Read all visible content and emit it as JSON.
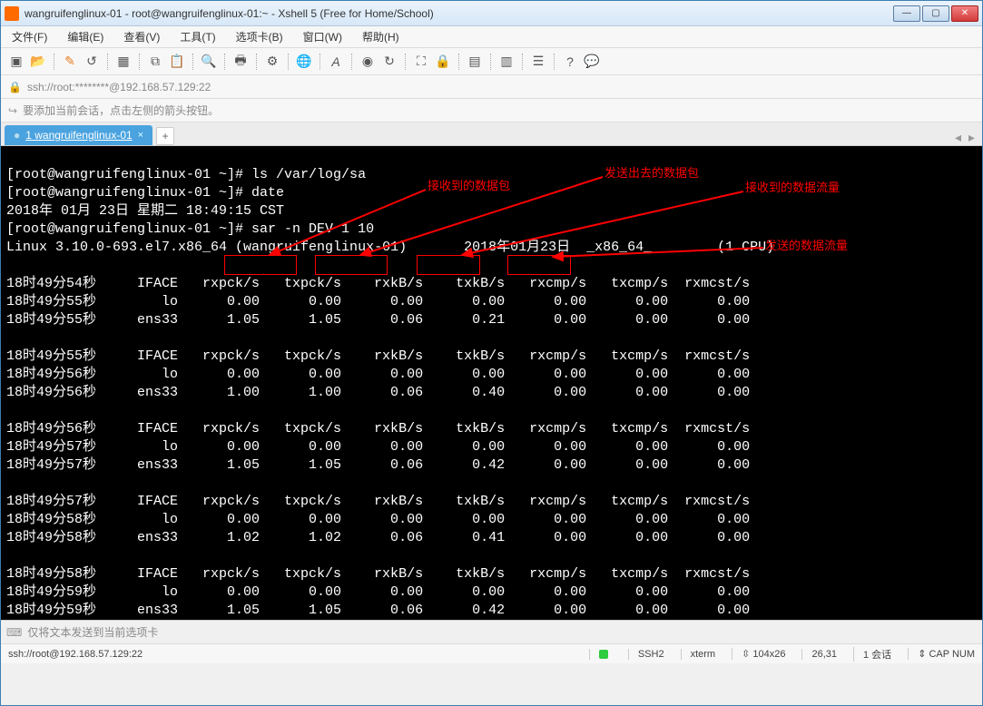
{
  "window": {
    "title": "wangruifenglinux-01 - root@wangruifenglinux-01:~ - Xshell 5 (Free for Home/School)"
  },
  "menus": [
    "文件(F)",
    "编辑(E)",
    "查看(V)",
    "工具(T)",
    "选项卡(B)",
    "窗口(W)",
    "帮助(H)"
  ],
  "address": "ssh://root:********@192.168.57.129:22",
  "hint": "要添加当前会话，点击左侧的箭头按钮。",
  "tab": {
    "label": "1 wangruifenglinux-01"
  },
  "annotations": {
    "a1": "接收到的数据包",
    "a2": "发送出去的数据包",
    "a3": "接收到的数据流量",
    "a4": "发送的数据流量"
  },
  "terminal": {
    "line1": "[root@wangruifenglinux-01 ~]# ls /var/log/sa",
    "line2": "[root@wangruifenglinux-01 ~]# date",
    "line3": "2018年 01月 23日 星期二 18:49:15 CST",
    "line4": "[root@wangruifenglinux-01 ~]# sar -n DEV 1 10",
    "line5": "Linux 3.10.0-693.el7.x86_64 (wangruifenglinux-01)       2018年01月23日  _x86_64_        (1 CPU)",
    "line6": "",
    "h1": "18时49分54秒     IFACE   rxpck/s   txpck/s    rxkB/s    txkB/s   rxcmp/s   txcmp/s  rxmcst/s",
    "r1a": "18时49分55秒        lo      0.00      0.00      0.00      0.00      0.00      0.00      0.00",
    "r1b": "18时49分55秒     ens33      1.05      1.05      0.06      0.21      0.00      0.00      0.00",
    "b1": "",
    "h2": "18时49分55秒     IFACE   rxpck/s   txpck/s    rxkB/s    txkB/s   rxcmp/s   txcmp/s  rxmcst/s",
    "r2a": "18时49分56秒        lo      0.00      0.00      0.00      0.00      0.00      0.00      0.00",
    "r2b": "18时49分56秒     ens33      1.00      1.00      0.06      0.40      0.00      0.00      0.00",
    "b2": "",
    "h3": "18时49分56秒     IFACE   rxpck/s   txpck/s    rxkB/s    txkB/s   rxcmp/s   txcmp/s  rxmcst/s",
    "r3a": "18时49分57秒        lo      0.00      0.00      0.00      0.00      0.00      0.00      0.00",
    "r3b": "18时49分57秒     ens33      1.05      1.05      0.06      0.42      0.00      0.00      0.00",
    "b3": "",
    "h4": "18时49分57秒     IFACE   rxpck/s   txpck/s    rxkB/s    txkB/s   rxcmp/s   txcmp/s  rxmcst/s",
    "r4a": "18时49分58秒        lo      0.00      0.00      0.00      0.00      0.00      0.00      0.00",
    "r4b": "18时49分58秒     ens33      1.02      1.02      0.06      0.41      0.00      0.00      0.00",
    "b4": "",
    "h5": "18时49分58秒     IFACE   rxpck/s   txpck/s    rxkB/s    txkB/s   rxcmp/s   txcmp/s  rxmcst/s",
    "r5a": "18时49分59秒        lo      0.00      0.00      0.00      0.00      0.00      0.00      0.00",
    "r5b": "18时49分59秒     ens33      1.05      1.05      0.06      0.42      0.00      0.00      0.00"
  },
  "inputhint": "仅将文本发送到当前选项卡",
  "status": {
    "conn": "ssh://root@192.168.57.129:22",
    "proto": "SSH2",
    "term": "xterm",
    "size": "104x26",
    "pos": "26,31",
    "sess": "1 会话",
    "caps": "CAP  NUM"
  }
}
